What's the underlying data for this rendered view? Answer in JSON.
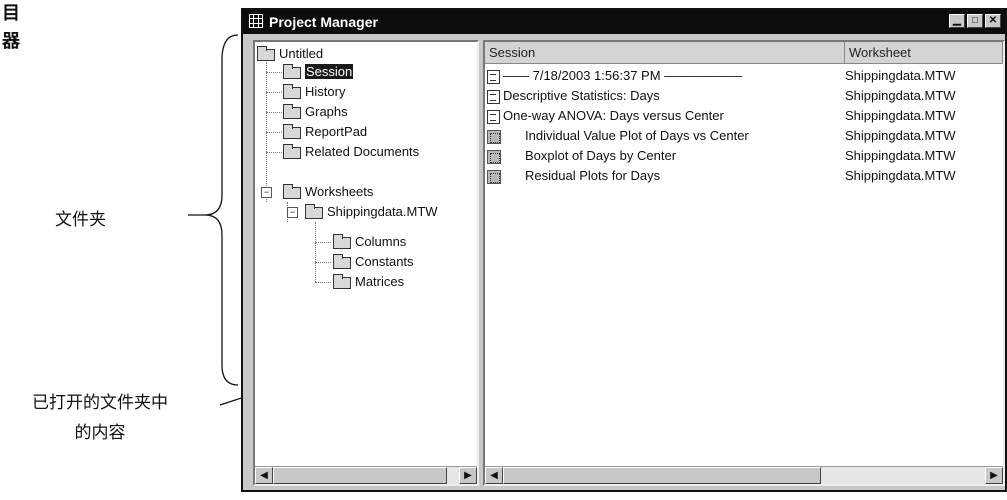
{
  "callouts": {
    "top_label_1": "目",
    "top_label_2": "器",
    "folders_label": "文件夹",
    "contents_label_1": "已打开的文件夹中",
    "contents_label_2": "的内容"
  },
  "window": {
    "title": "Project Manager",
    "buttons": {
      "minimize": "▁",
      "maximize": "□",
      "close": "✕"
    }
  },
  "tree": {
    "root": "Untitled",
    "session": "Session",
    "history": "History",
    "graphs": "Graphs",
    "reportpad": "ReportPad",
    "related": "Related Documents",
    "worksheets": "Worksheets",
    "worksheet_file": "Shippingdata.MTW",
    "columns": "Columns",
    "constants": "Constants",
    "matrices": "Matrices",
    "expander_minus": "−"
  },
  "content": {
    "headers": {
      "session": "Session",
      "worksheet": "Worksheet"
    },
    "rows": [
      {
        "icon": "doc-icon",
        "label": "—— 7/18/2003 1:56:37 PM ——————",
        "worksheet": "Shippingdata.MTW"
      },
      {
        "icon": "doc-icon",
        "label": "Descriptive Statistics: Days",
        "worksheet": "Shippingdata.MTW"
      },
      {
        "icon": "doc-icon",
        "label": "One-way ANOVA: Days versus Center",
        "worksheet": "Shippingdata.MTW"
      },
      {
        "icon": "graph-icon",
        "label": "Individual Value Plot of Days vs Center",
        "worksheet": "Shippingdata.MTW"
      },
      {
        "icon": "graph-icon",
        "label": "Boxplot of Days by Center",
        "worksheet": "Shippingdata.MTW"
      },
      {
        "icon": "graph-icon",
        "label": "Residual Plots for Days",
        "worksheet": "Shippingdata.MTW"
      }
    ]
  },
  "scroll": {
    "left_arrow": "◀",
    "right_arrow": "▶"
  }
}
